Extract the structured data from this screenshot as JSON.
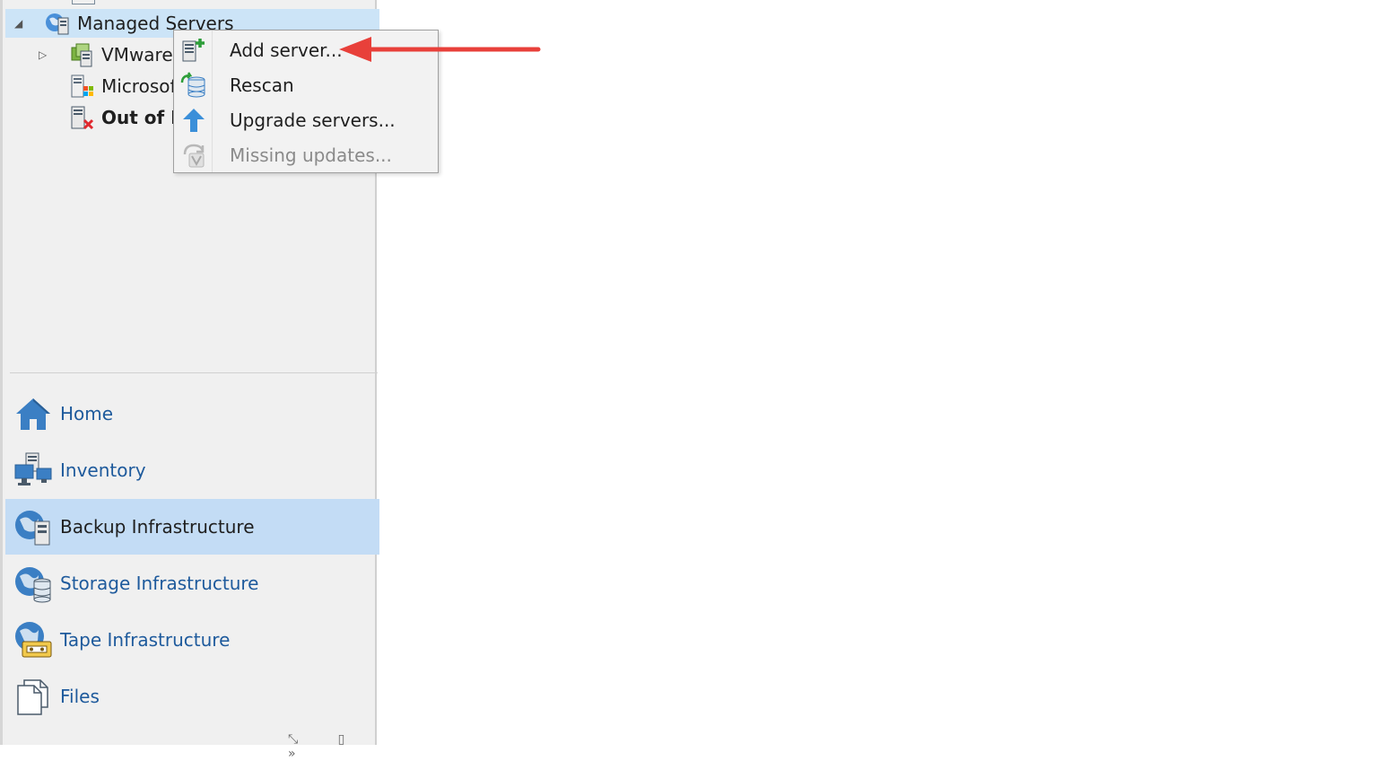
{
  "tree": {
    "root": {
      "label": "Managed Servers",
      "expander": "◢",
      "icon": "managed-servers-icon"
    },
    "children": [
      {
        "label": "VMware",
        "expander": "▷",
        "icon": "vmware-icon"
      },
      {
        "label": "Microsof",
        "icon": "microsoft-icon"
      },
      {
        "label": "Out of D",
        "icon": "out-of-date-icon"
      }
    ]
  },
  "context_menu": {
    "items": [
      {
        "label": "Add server...",
        "icon": "add-server-icon",
        "enabled": true
      },
      {
        "label": "Rescan",
        "icon": "rescan-icon",
        "enabled": true
      },
      {
        "label": "Upgrade servers...",
        "icon": "upgrade-arrow-icon",
        "enabled": true
      },
      {
        "label": "Missing updates...",
        "icon": "missing-updates-icon",
        "enabled": false
      }
    ]
  },
  "navigation": {
    "items": [
      {
        "label": "Home",
        "icon": "home-icon"
      },
      {
        "label": "Inventory",
        "icon": "inventory-icon"
      },
      {
        "label": "Backup Infrastructure",
        "icon": "backup-infrastructure-icon",
        "active": true
      },
      {
        "label": "Storage Infrastructure",
        "icon": "storage-infrastructure-icon"
      },
      {
        "label": "Tape Infrastructure",
        "icon": "tape-infrastructure-icon"
      },
      {
        "label": "Files",
        "icon": "files-icon"
      }
    ]
  },
  "colors": {
    "selection": "#cce4f7",
    "active_nav": "#c3dcf5",
    "nav_text": "#1e5a9c",
    "annotation_arrow": "#e8403a"
  }
}
